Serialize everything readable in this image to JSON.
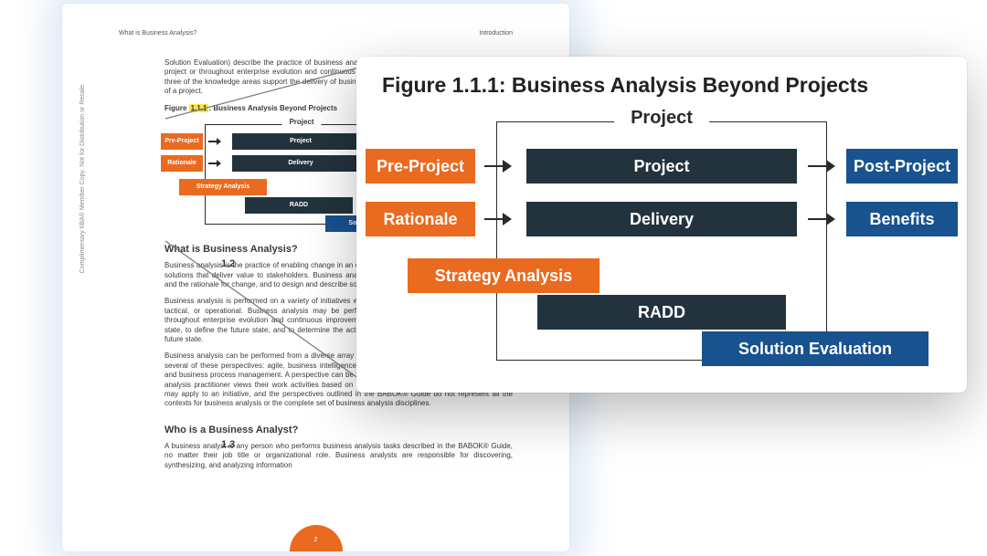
{
  "page": {
    "running_head_left": "What is Business Analysis?",
    "running_head_right": "Introduction",
    "watermark": "Complimentary IIBA® Member Copy. Not for Distribution or Resale.",
    "page_number": "2",
    "intro_paragraph": "Solution Evaluation) describe the practice of business analysis as it is applied within the boundaries of a project or throughout enterprise evolution and continuous improvement. The following image shows how three of the knowledge areas support the delivery of business value before, during, and after the life cycle of a project.",
    "figure_caption_prefix": "Figure ",
    "figure_number": "1.1.1",
    "figure_caption_suffix": ": Business Analysis Beyond Projects",
    "sections": {
      "s12_num": "1.2",
      "s12_title": "What is Business Analysis?",
      "s12_p1": "Business analysis is the practice of enabling change in an enterprise by defining needs and recommending solutions that deliver value to stakeholders. Business analysis enables an enterprise to articulate needs and the rationale for change, and to design and describe solutions that can deliver value.",
      "s12_p2": "Business analysis is performed on a variety of initiatives within an enterprise. Initiatives may be strategic, tactical, or operational. Business analysis may be performed within the boundaries of a project or throughout enterprise evolution and continuous improvement. It can be used to understand the current state, to define the future state, and to determine the activities required to move from the current to the future state.",
      "s12_p3": "Business analysis can be performed from a diverse array of perspectives. The BABOK® Guide describes several of these perspectives: agile, business intelligence, information technology, business architecture, and business process management. A perspective can be thought of as a lens through which the business analysis practitioner views their work activities based on the current context. One or many perspectives may apply to an initiative, and the perspectives outlined in the BABOK® Guide do not represent all the contexts for business analysis or the complete set of business analysis disciplines.",
      "s13_num": "1.3",
      "s13_title": "Who is a Business Analyst?",
      "s13_p1": "A business analyst is any person who performs business analysis tasks described in the BABOK® Guide, no matter their job title or organizational role. Business analysts are responsible for discovering, synthesizing, and analyzing information"
    }
  },
  "diagram": {
    "frame_label": "Project",
    "pre_project": "Pre-Project",
    "project": "Project",
    "post_project": "Post-Project",
    "rationale": "Rationale",
    "delivery": "Delivery",
    "benefits": "Benefits",
    "strategy": "Strategy Analysis",
    "radd": "RADD",
    "solution_eval": "Solution Evaluation"
  },
  "card": {
    "title": "Figure 1.1.1: Business Analysis Beyond Projects"
  },
  "chart_data": {
    "type": "diagram",
    "title": "Business Analysis Beyond Projects",
    "phase_frame": "Project",
    "phases": {
      "before": [
        "Pre-Project",
        "Rationale"
      ],
      "during": [
        "Project",
        "Delivery"
      ],
      "after": [
        "Post-Project",
        "Benefits"
      ]
    },
    "flow_arrows": [
      [
        "Pre-Project",
        "Project"
      ],
      [
        "Project",
        "Post-Project"
      ],
      [
        "Rationale",
        "Delivery"
      ],
      [
        "Delivery",
        "Benefits"
      ]
    ],
    "knowledge_area_bars": [
      {
        "name": "Strategy Analysis",
        "span": [
          "before",
          "during_start"
        ],
        "color": "#ea6a1f"
      },
      {
        "name": "RADD",
        "span": [
          "during"
        ],
        "color": "#22333d"
      },
      {
        "name": "Solution Evaluation",
        "span": [
          "during_end",
          "after"
        ],
        "color": "#18528f"
      }
    ],
    "color_legend": {
      "orange": "#ea6a1f",
      "navy": "#22333d",
      "blue": "#18528f"
    }
  }
}
